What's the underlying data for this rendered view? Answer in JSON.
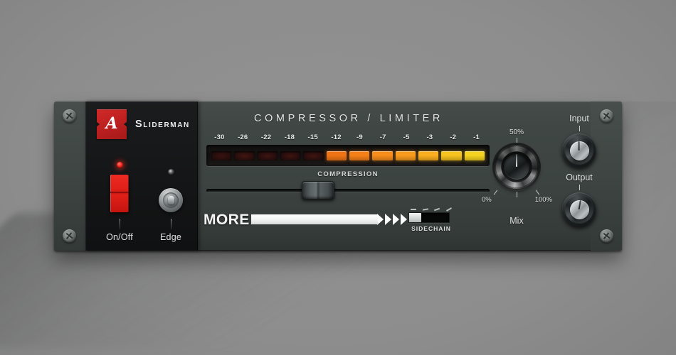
{
  "theme": {
    "background": "#8a8a8a",
    "panel": "#3d4442",
    "brand_panel": "#151617",
    "accent_red": "#c31813",
    "led_on": "#f0231c",
    "meter_lit_low": "#f0801a",
    "meter_lit_high": "#f5d320",
    "meter_off": "#3a1210"
  },
  "brand": {
    "logo_glyph": "A",
    "name": "Sliderman",
    "logo_icon_name": "sliderman-logo-icon"
  },
  "left_panel": {
    "power": {
      "label": "On/Off",
      "led_state": "on",
      "switch_type": "rocker",
      "switch_position": "up"
    },
    "edge": {
      "label": "Edge",
      "led_state": "off",
      "switch_type": "toggle",
      "switch_position": "center"
    }
  },
  "main": {
    "title": "COMPRESSOR / LIMITER",
    "compression_label": "COMPRESSION",
    "more": {
      "label": "MORE",
      "chevrons": "››››"
    },
    "sidechain": {
      "label": "SIDECHAIN",
      "state": "off",
      "handle_position": "left"
    },
    "compression_slider": {
      "value_percent": 38,
      "min": 0,
      "max": 100
    }
  },
  "meter": {
    "scale_labels": [
      "-30",
      "-26",
      "-22",
      "-18",
      "-15",
      "-12",
      "-9",
      "-7",
      "-5",
      "-3",
      "-2",
      "-1"
    ],
    "segment_count": 12,
    "lit_count": 7,
    "segments": [
      {
        "label": "-30",
        "lit": false,
        "color": "#3a1210"
      },
      {
        "label": "-26",
        "lit": false,
        "color": "#451512"
      },
      {
        "label": "-22",
        "lit": false,
        "color": "#3f1311"
      },
      {
        "label": "-18",
        "lit": false,
        "color": "#401311"
      },
      {
        "label": "-15",
        "lit": false,
        "color": "#421412"
      },
      {
        "label": "-12",
        "lit": true,
        "color": "#f07415"
      },
      {
        "label": "-9",
        "lit": true,
        "color": "#f58018"
      },
      {
        "label": "-7",
        "lit": true,
        "color": "#f78d1b"
      },
      {
        "label": "-5",
        "lit": true,
        "color": "#f99b1d"
      },
      {
        "label": "-3",
        "lit": true,
        "color": "#fbae1f"
      },
      {
        "label": "-2",
        "lit": true,
        "color": "#f6c31f"
      },
      {
        "label": "-1",
        "lit": true,
        "color": "#f5d320"
      }
    ]
  },
  "mix": {
    "name": "Mix",
    "top_label": "50%",
    "min_label": "0%",
    "max_label": "100%",
    "value_percent": 50,
    "pointer_angle_deg": 180
  },
  "input": {
    "label": "Input",
    "pointer_angle_deg": 180
  },
  "output": {
    "label": "Output",
    "pointer_angle_deg": 190
  },
  "chassis": {
    "screws": [
      "top-left",
      "bottom-left",
      "top-right",
      "bottom-right"
    ]
  }
}
